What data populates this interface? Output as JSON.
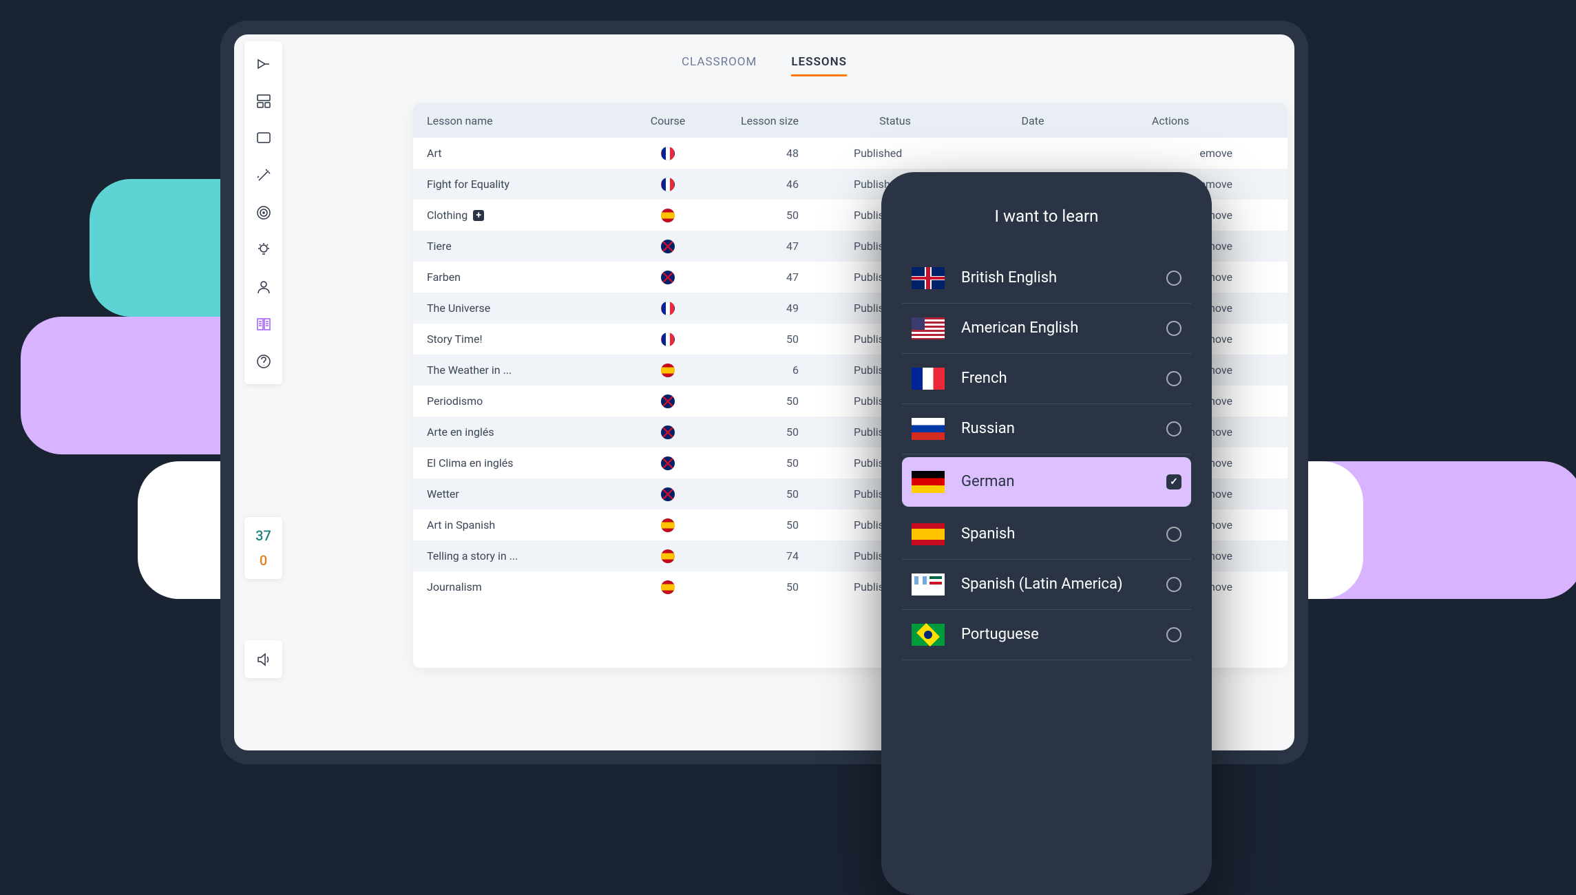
{
  "tabs": {
    "classroom": "CLASSROOM",
    "lessons": "LESSONS",
    "active": "lessons"
  },
  "sidebar": {
    "stat1": "37",
    "stat2": "0"
  },
  "table": {
    "headers": {
      "name": "Lesson name",
      "course": "Course",
      "size": "Lesson size",
      "status": "Status",
      "date": "Date",
      "actions": "Actions"
    },
    "action_label": "emove",
    "rows": [
      {
        "name": "Art",
        "plus": false,
        "flag": "fr",
        "size": "48",
        "status": "Published"
      },
      {
        "name": "Fight for Equality",
        "plus": false,
        "flag": "fr",
        "size": "46",
        "status": "Publishe"
      },
      {
        "name": "Clothing",
        "plus": true,
        "flag": "es",
        "size": "50",
        "status": "Publishe"
      },
      {
        "name": "Tiere",
        "plus": false,
        "flag": "gb",
        "size": "47",
        "status": "Publishe"
      },
      {
        "name": "Farben",
        "plus": false,
        "flag": "gb",
        "size": "47",
        "status": "Publishe"
      },
      {
        "name": "The Universe",
        "plus": false,
        "flag": "fr",
        "size": "49",
        "status": "Publishe"
      },
      {
        "name": "Story Time!",
        "plus": false,
        "flag": "fr",
        "size": "50",
        "status": "Publishe"
      },
      {
        "name": "The Weather in ...",
        "plus": false,
        "flag": "es",
        "size": "6",
        "status": "Publishe"
      },
      {
        "name": "Periodismo",
        "plus": false,
        "flag": "gb",
        "size": "50",
        "status": "Publishe"
      },
      {
        "name": "Arte en inglés",
        "plus": false,
        "flag": "gb",
        "size": "50",
        "status": "Publishe"
      },
      {
        "name": "El Clima en inglés",
        "plus": false,
        "flag": "gb",
        "size": "50",
        "status": "Publishe"
      },
      {
        "name": "Wetter",
        "plus": false,
        "flag": "gb",
        "size": "50",
        "status": "Publishe"
      },
      {
        "name": "Art in Spanish",
        "plus": false,
        "flag": "es",
        "size": "50",
        "status": "Publishe"
      },
      {
        "name": "Telling a story in ...",
        "plus": false,
        "flag": "es",
        "size": "74",
        "status": "Publishe"
      },
      {
        "name": "Journalism",
        "plus": false,
        "flag": "es",
        "size": "50",
        "status": "Publishe"
      }
    ]
  },
  "phone": {
    "title": "I want to learn",
    "languages": [
      {
        "label": "British English",
        "flag": "gb",
        "selected": false
      },
      {
        "label": "American English",
        "flag": "us",
        "selected": false
      },
      {
        "label": "French",
        "flag": "fr",
        "selected": false
      },
      {
        "label": "Russian",
        "flag": "ru",
        "selected": false
      },
      {
        "label": "German",
        "flag": "de",
        "selected": true
      },
      {
        "label": "Spanish",
        "flag": "es",
        "selected": false
      },
      {
        "label": "Spanish (Latin America)",
        "flag": "latam",
        "selected": false
      },
      {
        "label": "Portuguese",
        "flag": "br",
        "selected": false
      }
    ]
  }
}
